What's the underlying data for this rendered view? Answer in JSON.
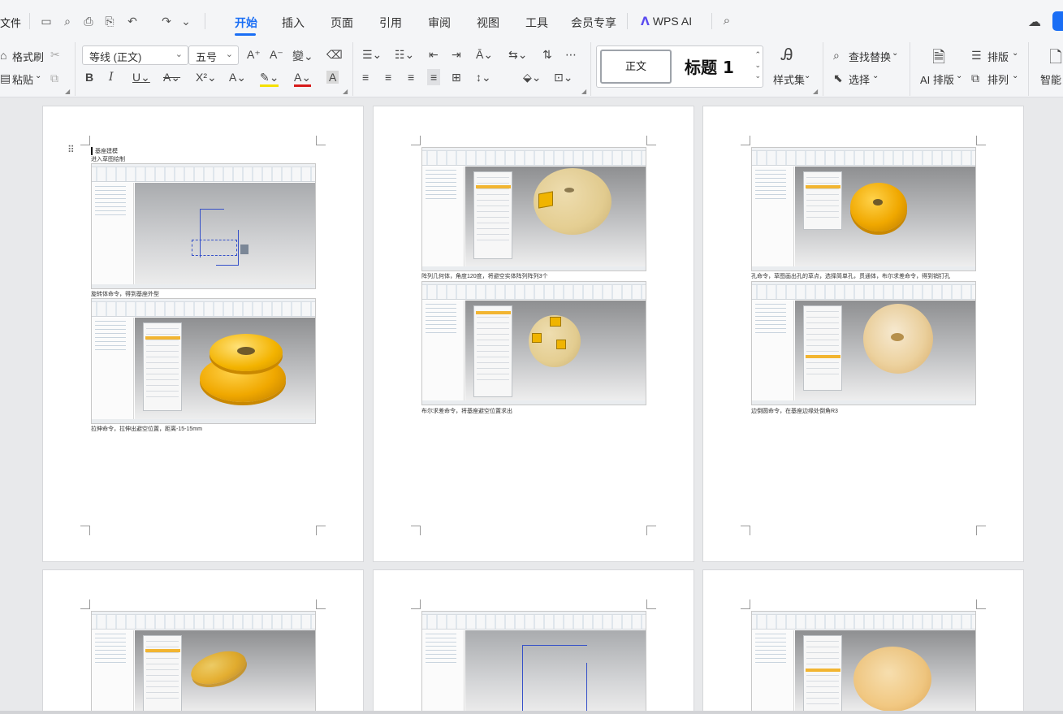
{
  "menubar": {
    "file": "文件",
    "tabs": [
      "开始",
      "插入",
      "页面",
      "引用",
      "审阅",
      "视图",
      "工具",
      "会员专享"
    ],
    "active_tab": "开始",
    "wps_ai": "WPS AI",
    "accent_color": "#1a6ef5"
  },
  "ribbon": {
    "format_painter": "格式刷",
    "paste": "粘贴",
    "font_name": "等线 (正文)",
    "font_size": "五号",
    "find_replace": "查找替换",
    "select": "选择",
    "style_normal": "正文",
    "style_heading": "标题 1",
    "style_set": "样式集",
    "ai_layout": "AI 排版",
    "typeset": "排版",
    "arrange": "排列",
    "smart": "智能"
  },
  "document": {
    "page1": {
      "heading": "基座建模",
      "line1": "进入草图绘制",
      "caption1": "旋转体命令，得到基座外型",
      "caption2": "拉伸命令，拉伸出避空位置，距离-15-15mm"
    },
    "page2": {
      "caption1": "阵列几何体，角度120度，将避空实体阵列阵列3个",
      "caption2": "布尔求差命令，将基座避空位置求出"
    },
    "page3": {
      "caption1": "孔命令，草图画出孔的草点，选择简单孔，贯通体，布尔求差命令，得到销钉孔",
      "caption2": "边倒圆命令，在基座边缘处倒角R3"
    }
  }
}
